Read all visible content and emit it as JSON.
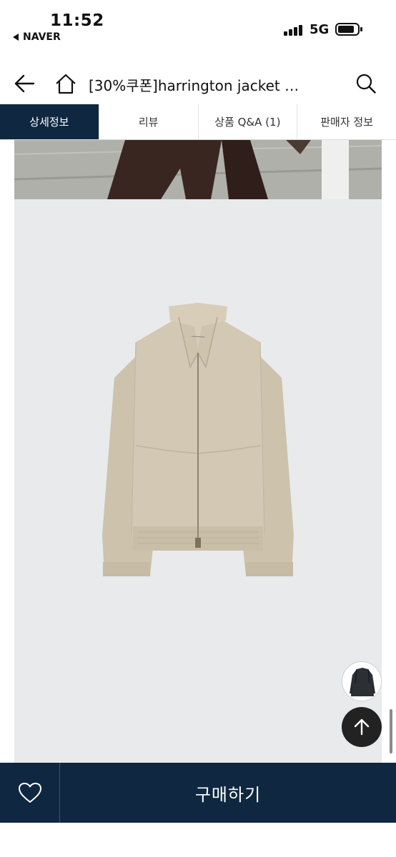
{
  "status_bar": {
    "time": "11:52",
    "back_app": "NAVER",
    "network": "5G"
  },
  "nav": {
    "title": "[30%쿠폰]harrington jacket …",
    "icons": [
      "back-arrow-icon",
      "home-icon",
      "search-icon"
    ]
  },
  "tabs": [
    {
      "label": "상세정보",
      "active": true
    },
    {
      "label": "리뷰",
      "active": false
    },
    {
      "label": "상품 Q&A (1)",
      "active": false
    },
    {
      "label": "판매자 정보",
      "active": false
    }
  ],
  "buy_bar": {
    "buy_label": "구매하기",
    "wish_icon": "heart-icon"
  },
  "colors": {
    "navy": "#0f2740",
    "jacket": "#cdc2ac",
    "image_bg": "#e9eaec"
  }
}
